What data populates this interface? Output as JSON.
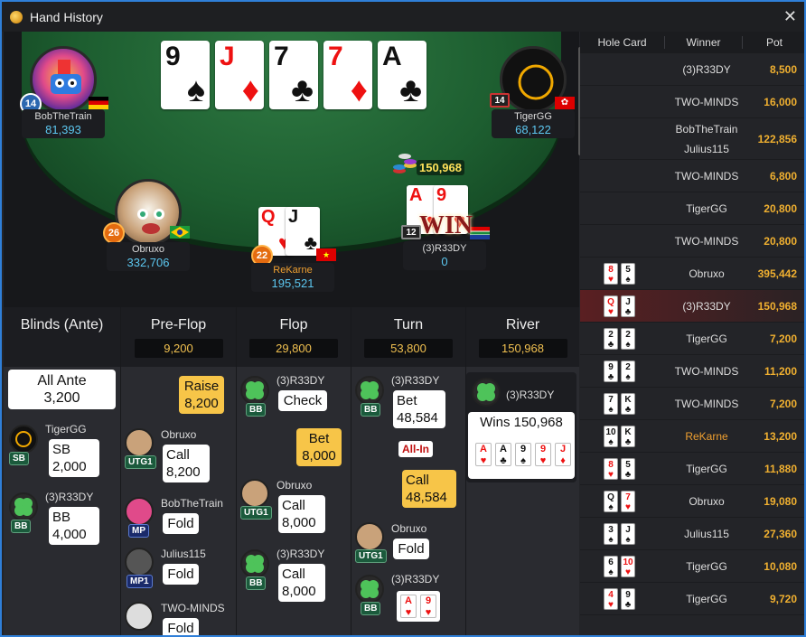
{
  "window": {
    "title": "Hand History"
  },
  "board": {
    "cards": [
      {
        "rank": "9",
        "suit": "♠",
        "color": "blk"
      },
      {
        "rank": "J",
        "suit": "♦",
        "color": "red"
      },
      {
        "rank": "7",
        "suit": "♣",
        "color": "blk"
      },
      {
        "rank": "7",
        "suit": "♦",
        "color": "red"
      },
      {
        "rank": "A",
        "suit": "♣",
        "color": "blk"
      }
    ]
  },
  "seats": {
    "bob": {
      "name": "BobTheTrain",
      "chips": "81,393",
      "level": "14"
    },
    "tiger": {
      "name": "TigerGG",
      "chips": "68,122",
      "level": "14"
    },
    "obruxo": {
      "name": "Obruxo",
      "chips": "332,706",
      "level": "26"
    },
    "rekarne": {
      "name": "ReKarne",
      "chips": "195,521",
      "level": "22",
      "cards": [
        {
          "rank": "Q",
          "suit": "♥",
          "color": "red"
        },
        {
          "rank": "J",
          "suit": "♣",
          "color": "blk"
        }
      ]
    },
    "r33dy": {
      "name": "(3)R33DY",
      "chips": "0",
      "level": "12",
      "cards": [
        {
          "rank": "A",
          "suit": "♥",
          "color": "red"
        },
        {
          "rank": "9",
          "suit": "♥",
          "color": "red"
        }
      ]
    }
  },
  "pot": "150,968",
  "win_label": "WIN",
  "streets": {
    "blinds": {
      "label": "Blinds (Ante)"
    },
    "preflop": {
      "label": "Pre-Flop",
      "total": "9,200"
    },
    "flop": {
      "label": "Flop",
      "total": "29,800"
    },
    "turn": {
      "label": "Turn",
      "total": "53,800"
    },
    "river": {
      "label": "River",
      "total": "150,968"
    }
  },
  "blinds_col": {
    "ante_label": "All Ante",
    "ante_value": "3,200",
    "sb_name": "TigerGG",
    "sb_pos": "SB",
    "sb_label": "SB",
    "sb_value": "2,000",
    "bb_name": "(3)R33DY",
    "bb_pos": "BB",
    "bb_label": "BB",
    "bb_value": "4,000"
  },
  "preflop_col": {
    "raise_label": "Raise",
    "raise_value": "8,200",
    "a1_name": "Obruxo",
    "a1_pos": "UTG1",
    "a1_act": "Call",
    "a1_val": "8,200",
    "a2_name": "BobTheTrain",
    "a2_pos": "MP",
    "a2_act": "Fold",
    "a3_name": "Julius115",
    "a3_pos": "MP1",
    "a3_act": "Fold",
    "a4_name": "TWO-MINDS",
    "a4_act": "Fold"
  },
  "flop_col": {
    "a1_name": "(3)R33DY",
    "a1_pos": "BB",
    "a1_act": "Check",
    "bet_label": "Bet",
    "bet_value": "8,000",
    "a2_name": "Obruxo",
    "a2_pos": "UTG1",
    "a2_act": "Call",
    "a2_val": "8,000",
    "a3_name": "(3)R33DY",
    "a3_pos": "BB",
    "a3_act": "Call",
    "a3_val": "8,000"
  },
  "turn_col": {
    "a1_name": "(3)R33DY",
    "a1_pos": "BB",
    "a1_act": "Bet",
    "a1_val": "48,584",
    "allin": "All-In",
    "call_label": "Call",
    "call_value": "48,584",
    "a2_name": "Obruxo",
    "a2_pos": "UTG1",
    "a2_act": "Fold",
    "a3_name": "(3)R33DY",
    "a3_pos": "BB",
    "a3_cards": [
      {
        "rank": "A",
        "suit": "♥",
        "color": "red"
      },
      {
        "rank": "9",
        "suit": "♥",
        "color": "red"
      }
    ]
  },
  "river_col": {
    "name": "(3)R33DY",
    "wins": "Wins 150,968",
    "cards": [
      {
        "rank": "A",
        "suit": "♥",
        "color": "red"
      },
      {
        "rank": "A",
        "suit": "♣",
        "color": "blk"
      },
      {
        "rank": "9",
        "suit": "♠",
        "color": "blk"
      },
      {
        "rank": "9",
        "suit": "♥",
        "color": "red"
      },
      {
        "rank": "J",
        "suit": "♦",
        "color": "red"
      }
    ]
  },
  "history": {
    "headers": [
      "Hole Card",
      "Winner",
      "Pot"
    ],
    "rows": [
      {
        "winner": "(3)R33DY",
        "pot": "8,500"
      },
      {
        "winner": "TWO-MINDS",
        "pot": "16,000"
      },
      {
        "winner": "BobTheTrain",
        "winner2": "Julius115",
        "pot": "122,856"
      },
      {
        "winner": "TWO-MINDS",
        "pot": "6,800"
      },
      {
        "winner": "TigerGG",
        "pot": "20,800"
      },
      {
        "winner": "TWO-MINDS",
        "pot": "20,800"
      },
      {
        "winner": "Obruxo",
        "pot": "395,442",
        "c1": "8",
        "s1": "♥",
        "k1": "red",
        "c2": "5",
        "s2": "♠",
        "k2": "blk"
      },
      {
        "winner": "(3)R33DY",
        "pot": "150,968",
        "c1": "Q",
        "s1": "♥",
        "k1": "red",
        "c2": "J",
        "s2": "♣",
        "k2": "blk",
        "selected": true
      },
      {
        "winner": "TigerGG",
        "pot": "7,200",
        "c1": "2",
        "s1": "♣",
        "k1": "blk",
        "c2": "2",
        "s2": "♠",
        "k2": "blk"
      },
      {
        "winner": "TWO-MINDS",
        "pot": "11,200",
        "c1": "9",
        "s1": "♣",
        "k1": "blk",
        "c2": "2",
        "s2": "♠",
        "k2": "blk"
      },
      {
        "winner": "TWO-MINDS",
        "pot": "7,200",
        "c1": "7",
        "s1": "♠",
        "k1": "blk",
        "c2": "K",
        "s2": "♣",
        "k2": "blk"
      },
      {
        "winner": "ReKarne",
        "pot": "13,200",
        "c1": "10",
        "s1": "♠",
        "k1": "blk",
        "c2": "K",
        "s2": "♣",
        "k2": "blk",
        "highlight": true
      },
      {
        "winner": "TigerGG",
        "pot": "11,880",
        "c1": "8",
        "s1": "♥",
        "k1": "red",
        "c2": "5",
        "s2": "♣",
        "k2": "blk"
      },
      {
        "winner": "Obruxo",
        "pot": "19,080",
        "c1": "Q",
        "s1": "♠",
        "k1": "blk",
        "c2": "7",
        "s2": "♥",
        "k2": "red"
      },
      {
        "winner": "Julius115",
        "pot": "27,360",
        "c1": "3",
        "s1": "♠",
        "k1": "blk",
        "c2": "J",
        "s2": "♠",
        "k2": "blk"
      },
      {
        "winner": "TigerGG",
        "pot": "10,080",
        "c1": "6",
        "s1": "♠",
        "k1": "blk",
        "c2": "10",
        "s2": "♥",
        "k2": "red"
      },
      {
        "winner": "TigerGG",
        "pot": "9,720",
        "c1": "4",
        "s1": "♥",
        "k1": "red",
        "c2": "9",
        "s2": "♣",
        "k2": "blk"
      }
    ]
  },
  "colors": {
    "accent": "#2f7fd8",
    "pot": "#f0b030",
    "chips": "#5cc7f0",
    "felt": "#1d5e30"
  }
}
